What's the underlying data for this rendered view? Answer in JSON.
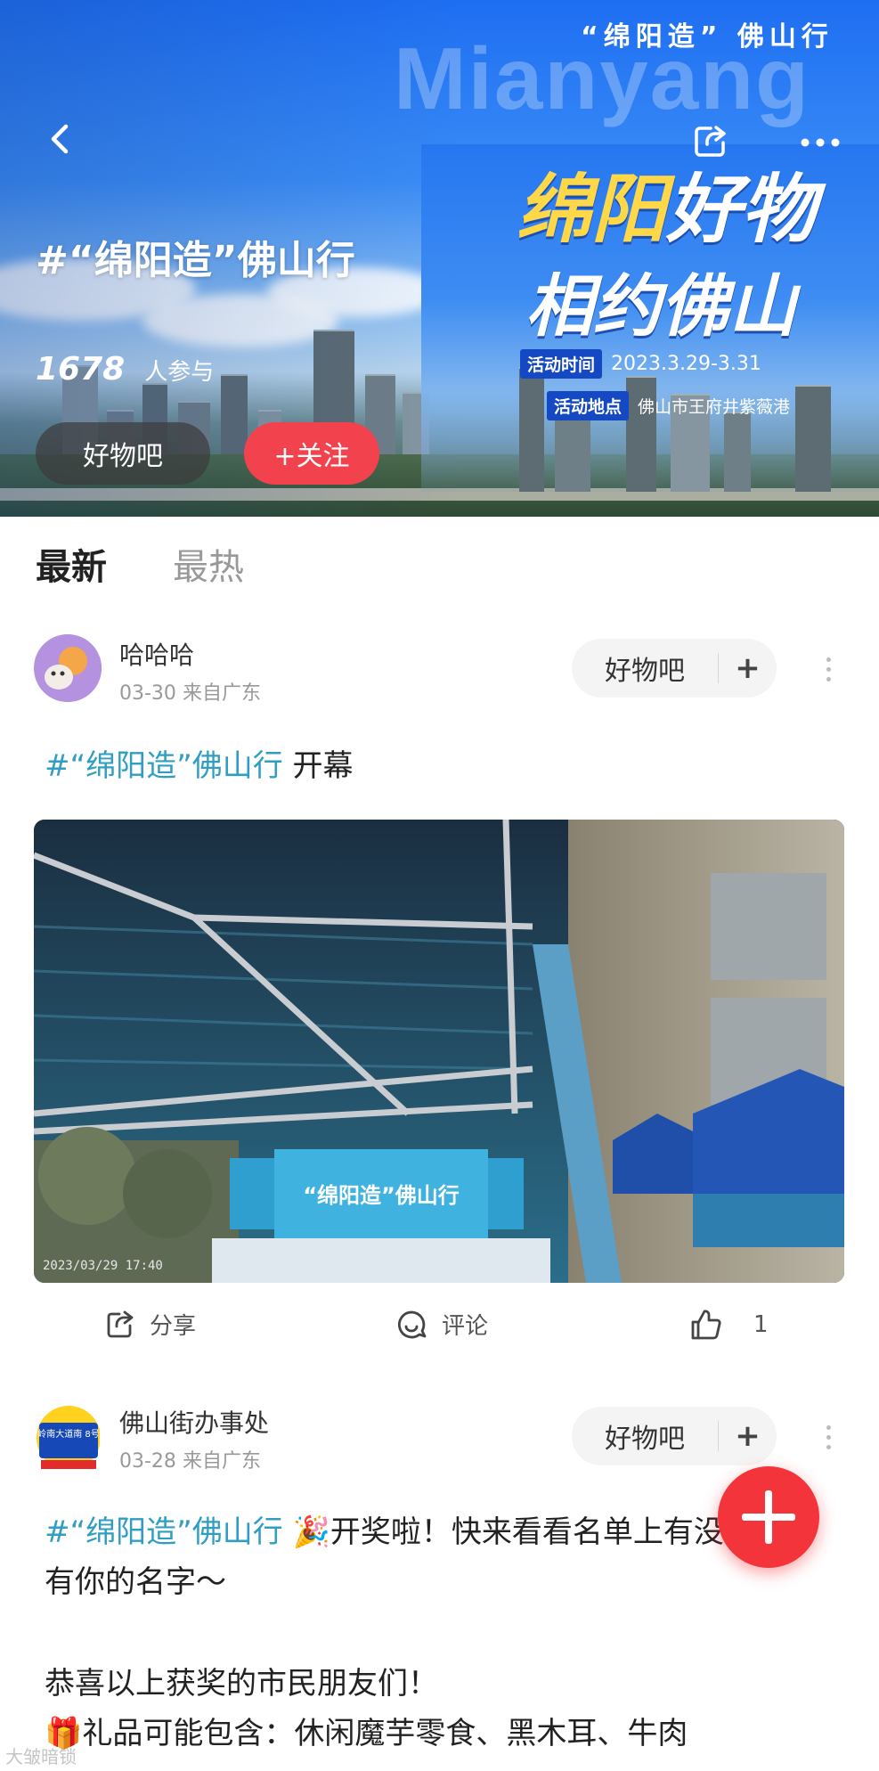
{
  "hero": {
    "bg_word": "Mianyang",
    "slogan": "“绵阳造” 佛山行",
    "banner_line1_a": "绵阳",
    "banner_line1_b": "好物",
    "banner_line2": "相约佛山",
    "time_tag": "活动时间",
    "time_value": "2023.3.29-3.31",
    "place_tag": "活动地点",
    "place_value": "佛山市王府井紫薇港",
    "topic_title": "#“绵阳造”佛山行",
    "participant_count": "1678",
    "participant_label": "人参与",
    "forum_chip": "好物吧",
    "follow_label": "+关注"
  },
  "icons": {
    "back": "back-chevron-icon",
    "share": "share-icon",
    "more": "more-icon"
  },
  "tabs": [
    {
      "label": "最新",
      "active": true
    },
    {
      "label": "最热",
      "active": false
    }
  ],
  "posts": [
    {
      "username": "哈哈哈",
      "date": "03-30",
      "source": "来自广东",
      "forum": "好物吧",
      "forum_plus": "+",
      "hashtag": "#“绵阳造”佛山行",
      "text": " 开幕",
      "image_caption": "“绵阳造”佛山行",
      "image_timestamp": "2023/03/29 17:40",
      "actions": {
        "share": "分享",
        "comment": "评论",
        "like_count": "1"
      }
    },
    {
      "username": "佛山街办事处",
      "avatar_text": "岭南大道南 8号",
      "date": "03-28",
      "source": "来自广东",
      "forum": "好物吧",
      "forum_plus": "+",
      "hashtag": "#“绵阳造”佛山行",
      "emoji": "🎉",
      "text_line1": "开奖啦！快来看看名单上有没",
      "text_line2": "有你的名字～",
      "text_line3": "恭喜以上获奖的市民朋友们！",
      "gift_emoji": "🎁",
      "text_line4": "礼品可能包含：休闲魔芋零食、黑木耳、牛肉"
    }
  ],
  "watermark": "大皱暗锁",
  "colors": {
    "accent_red": "#f3343a",
    "hashtag_blue": "#2f9ec2",
    "hero_blue": "#1e6ef2"
  }
}
